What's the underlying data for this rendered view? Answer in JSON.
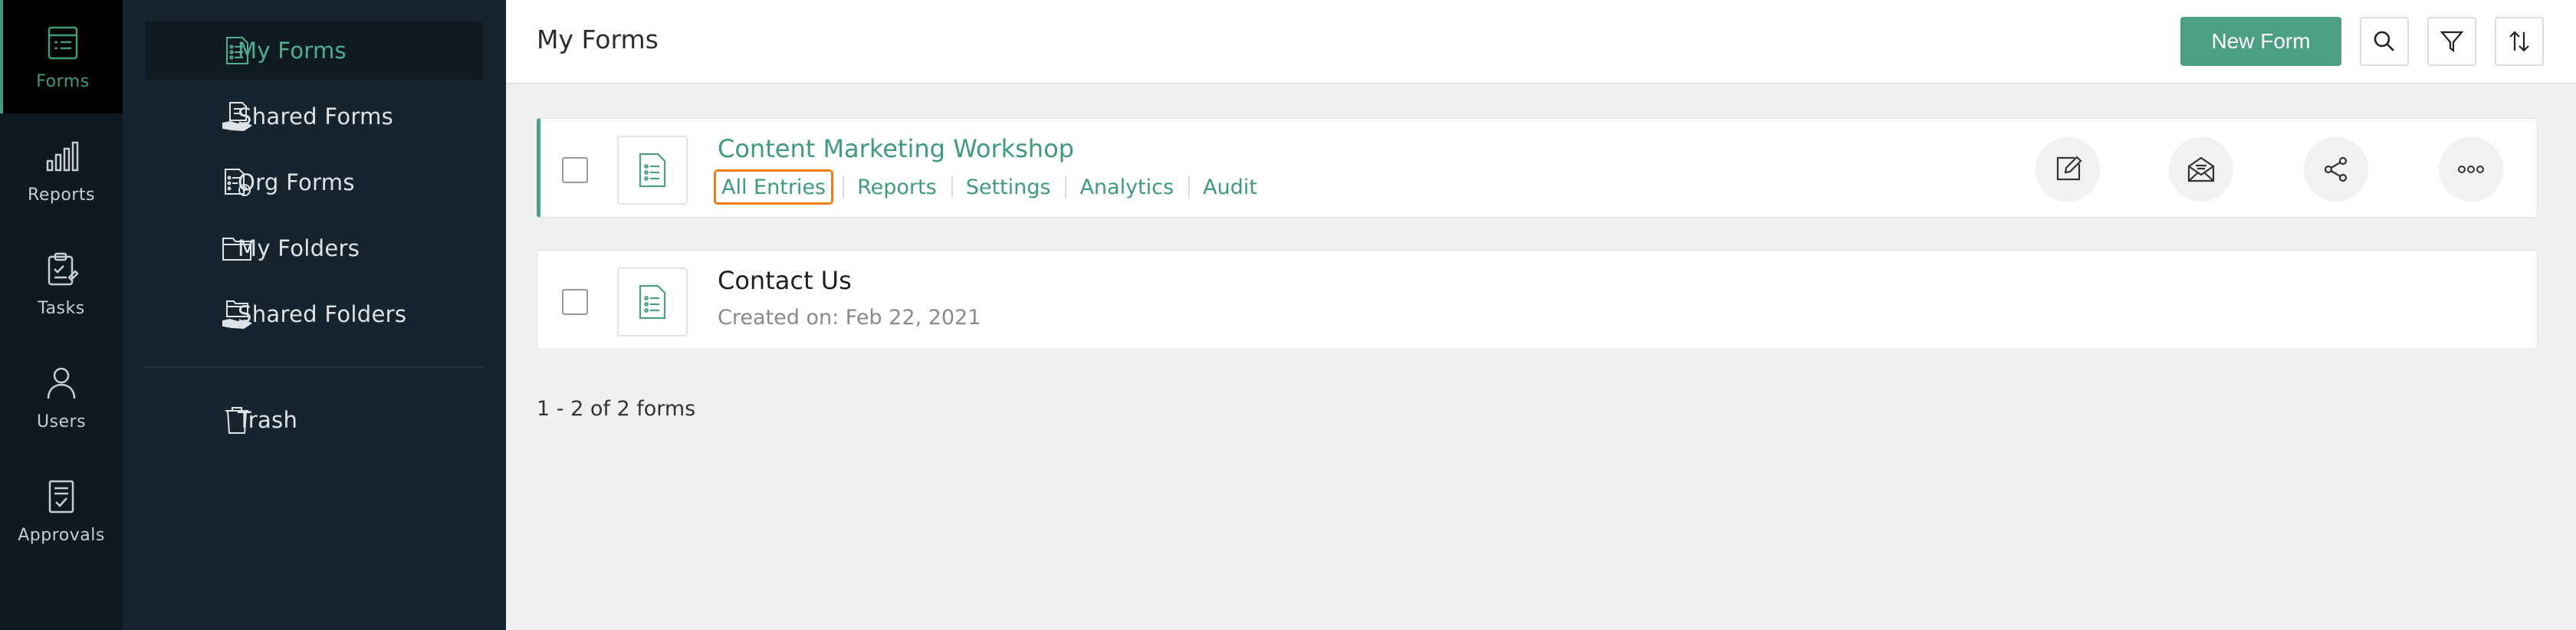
{
  "rail": {
    "items": [
      {
        "label": "Forms",
        "icon": "forms-icon"
      },
      {
        "label": "Reports",
        "icon": "bar-chart-icon"
      },
      {
        "label": "Tasks",
        "icon": "clipboard-check-icon"
      },
      {
        "label": "Users",
        "icon": "user-icon"
      },
      {
        "label": "Approvals",
        "icon": "approval-doc-icon"
      }
    ]
  },
  "sidebar": {
    "items": [
      {
        "label": "My Forms",
        "icon": "form-doc-icon"
      },
      {
        "label": "Shared Forms",
        "icon": "shared-form-icon"
      },
      {
        "label": "Org Forms",
        "icon": "org-form-icon"
      },
      {
        "label": "My Folders",
        "icon": "folder-icon"
      },
      {
        "label": "Shared Folders",
        "icon": "shared-folder-icon"
      },
      {
        "label": "Trash",
        "icon": "trash-icon"
      }
    ]
  },
  "header": {
    "title": "My Forms",
    "new_form_label": "New Form"
  },
  "forms": [
    {
      "title": "Content Marketing Workshop",
      "links": [
        "All Entries",
        "Reports",
        "Settings",
        "Analytics",
        "Audit"
      ]
    },
    {
      "title": "Contact Us",
      "created_label": "Created on:",
      "created_date": "Feb 22, 2021"
    }
  ],
  "footer": {
    "count_text": "1 - 2 of 2 forms"
  },
  "colors": {
    "accent": "#4a9f85",
    "focus_outline": "#f07e12",
    "sidebar_bg": "#162430",
    "rail_bg": "#0f1922"
  }
}
